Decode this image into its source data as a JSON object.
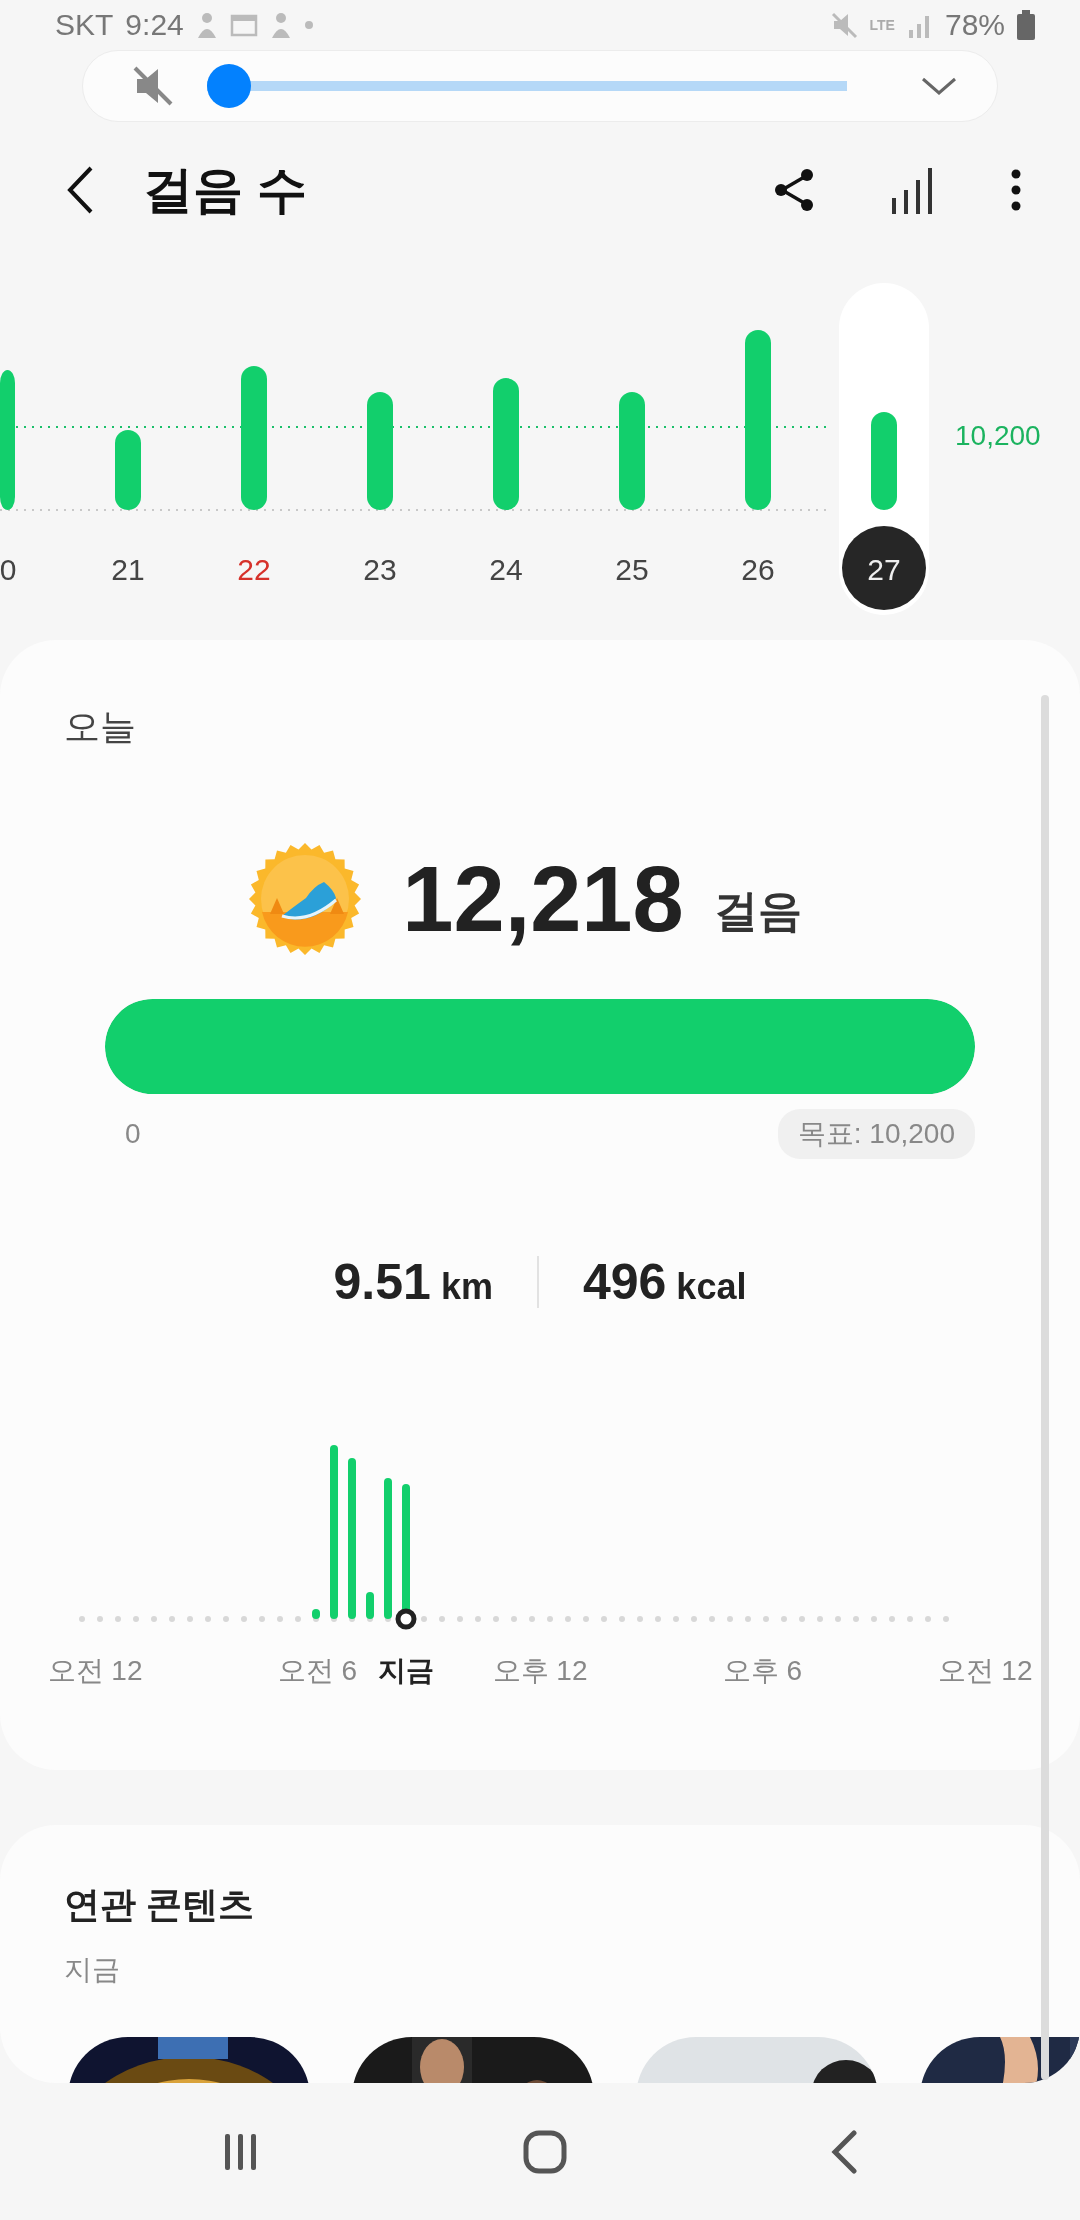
{
  "status_bar": {
    "carrier": "SKT",
    "time": "9:24",
    "network": "LTE",
    "battery": "78%"
  },
  "volume_panel": {
    "muted": true,
    "level": 0
  },
  "header": {
    "title": "걸음 수"
  },
  "weekly_chart": {
    "goal_label": "10,200",
    "days": [
      {
        "label": "0",
        "kind": "weekday",
        "selected": false
      },
      {
        "label": "21",
        "kind": "weekday",
        "selected": false
      },
      {
        "label": "22",
        "kind": "sunday",
        "selected": false
      },
      {
        "label": "23",
        "kind": "weekday",
        "selected": false
      },
      {
        "label": "24",
        "kind": "weekday",
        "selected": false
      },
      {
        "label": "25",
        "kind": "weekday",
        "selected": false
      },
      {
        "label": "26",
        "kind": "weekday",
        "selected": false
      },
      {
        "label": "27",
        "kind": "weekday",
        "selected": true
      }
    ]
  },
  "today": {
    "title": "오늘",
    "steps": "12,218",
    "steps_unit": "걸음",
    "progress": {
      "level": 1,
      "min_label": "0",
      "goal_label": "목표: 10,200"
    },
    "distance": {
      "value": "9.51",
      "unit": "km"
    },
    "calories": {
      "value": "496",
      "unit": "kcal"
    },
    "hourly_chart": {
      "labels": [
        {
          "text": "오전 12",
          "kind": "tick"
        },
        {
          "text": "오전 6",
          "kind": "tick"
        },
        {
          "text": "지금",
          "kind": "now"
        },
        {
          "text": "오후 12",
          "kind": "tick"
        },
        {
          "text": "오후 6",
          "kind": "tick"
        },
        {
          "text": "오전 12",
          "kind": "tick"
        }
      ]
    }
  },
  "related": {
    "title": "연관 콘텐츠",
    "subtitle": "지금"
  }
}
